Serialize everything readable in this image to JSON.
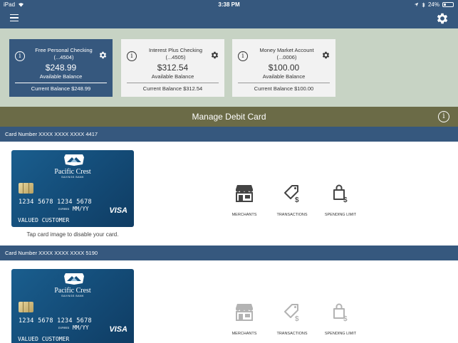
{
  "status": {
    "device": "iPad",
    "time": "3:38 PM",
    "battery": "24%",
    "battery_level": 0.24
  },
  "accounts": [
    {
      "name": "Free Personal Checking",
      "number": "(...4504)",
      "amount": "$248.99",
      "available_label": "Available Balance",
      "current": "Current Balance $248.99",
      "selected": true
    },
    {
      "name": "Interest Plus Checking",
      "number": "(...4505)",
      "amount": "$312.54",
      "available_label": "Available Balance",
      "current": "Current Balance $312.54",
      "selected": false
    },
    {
      "name": "Money Market Account",
      "number": "(...0006)",
      "amount": "$100.00",
      "available_label": "Available Balance",
      "current": "Current Balance $100.00",
      "selected": false
    }
  ],
  "banner": {
    "title": "Manage Debit Card"
  },
  "cards": [
    {
      "header": "Card Number XXXX XXXX XXXX 4417",
      "bank_name": "Pacific Crest",
      "bank_sub": "SAVINGS BANK",
      "number": "1234 5678 1234 5678",
      "expires_label": "EXPIRES",
      "expiry": "MM/YY",
      "holder": "VALUED CUSTOMER",
      "network": "VISA",
      "tap_note": "Tap card image to disable your card.",
      "actions": [
        "MERCHANTS",
        "TRANSACTIONS",
        "SPENDING LIMIT"
      ]
    },
    {
      "header": "Card Number XXXX XXXX XXXX 5190",
      "bank_name": "Pacific Crest",
      "bank_sub": "SAVINGS BANK",
      "number": "1234 5678 1234 5678",
      "expires_label": "EXPIRES",
      "expiry": "MM/YY",
      "holder": "VALUED CUSTOMER",
      "network": "VISA",
      "actions": [
        "MERCHANTS",
        "TRANSACTIONS",
        "SPENDING LIMIT"
      ]
    }
  ],
  "icons": {
    "menu": "hamburger-icon",
    "settings": "gear-icon",
    "info": "info-icon",
    "merchants": "storefront-icon",
    "transactions": "price-tag-dollar-icon",
    "spending_limit": "shopping-bag-dollar-icon"
  },
  "colors": {
    "primary": "#36587e",
    "accounts_bg": "#c7d3c4",
    "banner": "#6b6b47",
    "card": "#15507d"
  }
}
